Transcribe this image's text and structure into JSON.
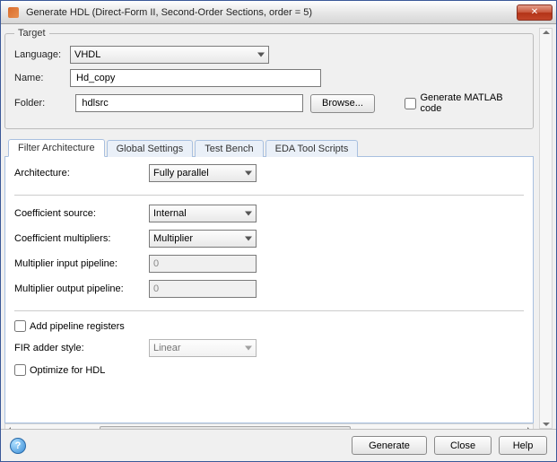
{
  "window": {
    "title": "Generate HDL (Direct-Form II, Second-Order Sections, order = 5)"
  },
  "target": {
    "legend": "Target",
    "language_label": "Language:",
    "language_value": "VHDL",
    "name_label": "Name:",
    "name_value": "Hd_copy",
    "folder_label": "Folder:",
    "folder_value": "hdlsrc",
    "browse_label": "Browse...",
    "gen_matlab_label": "Generate MATLAB code"
  },
  "tabs": {
    "items": [
      {
        "label": "Filter Architecture",
        "active": true
      },
      {
        "label": "Global Settings",
        "active": false
      },
      {
        "label": "Test Bench",
        "active": false
      },
      {
        "label": "EDA Tool Scripts",
        "active": false
      }
    ]
  },
  "arch": {
    "architecture_label": "Architecture:",
    "architecture_value": "Fully parallel",
    "coef_source_label": "Coefficient source:",
    "coef_source_value": "Internal",
    "coef_mult_label": "Coefficient multipliers:",
    "coef_mult_value": "Multiplier",
    "mult_in_label": "Multiplier input pipeline:",
    "mult_in_value": "0",
    "mult_out_label": "Multiplier output pipeline:",
    "mult_out_value": "0",
    "add_pipeline_label": "Add pipeline registers",
    "fir_adder_label": "FIR adder style:",
    "fir_adder_value": "Linear",
    "optimize_label": "Optimize for HDL"
  },
  "footer": {
    "generate": "Generate",
    "close": "Close",
    "help": "Help"
  }
}
